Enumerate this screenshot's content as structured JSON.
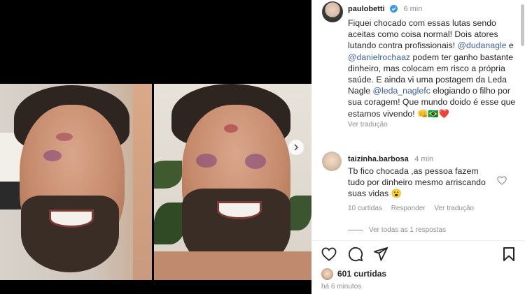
{
  "post": {
    "author": "paulobetti",
    "time": "6 min",
    "caption_parts": [
      "Fiquei chocado com essas lutas sendo aceitas como coisa normal! Dois atores lutando contra profissionais! ",
      "@dudanagle",
      " e ",
      "@danielrochaaz",
      " podem ter ganho bastante dinheiro, mas colocam em risco a própria saúde. E ainda vi uma postagem da Leda Nagle ",
      "@leda_naglefc",
      " elogiando o filho por sua coragem! Que mundo doido é esse que estamos vivendo! 👊🇧🇷❤️"
    ],
    "see_translation": "Ver tradução"
  },
  "comment": {
    "author": "taizinha.barbosa",
    "time": "4 min",
    "text": "Tb fico chocada ,as pessoa fazem tudo por dinheiro mesmo arriscando suas vidas 😮",
    "likes": "10 curtidas",
    "reply": "Responder",
    "see_translation": "Ver tradução",
    "view_replies": "Ver todas as 1 respostas"
  },
  "footer": {
    "likes": "601 curtidas",
    "timestamp": "há 6 minutos"
  },
  "icons": {
    "like": "heart-icon",
    "comment": "comment-bubble-icon",
    "share": "paper-plane-icon",
    "save": "bookmark-icon",
    "verified": "verified-badge-icon",
    "next": "chevron-right-icon"
  },
  "colors": {
    "mention": "#3b5ea8",
    "verified": "#3897f0",
    "muted": "#8e8e8e"
  }
}
